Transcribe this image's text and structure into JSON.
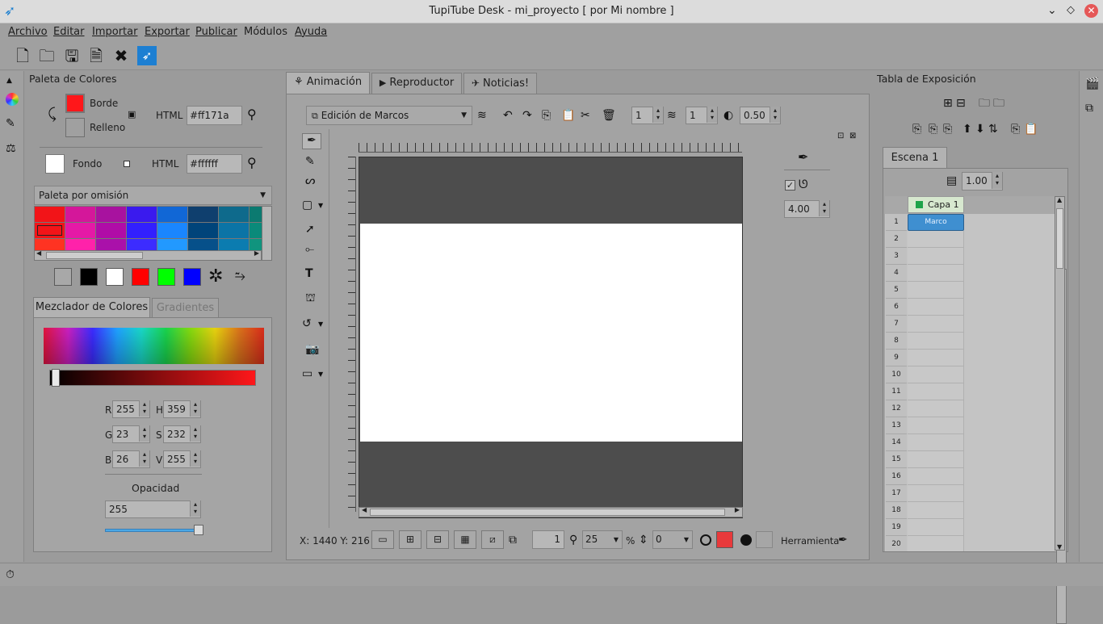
{
  "window": {
    "title": "TupiTube Desk - mi_proyecto [ por Mi nombre ]"
  },
  "menu": [
    "Archivo",
    "Editar",
    "Importar",
    "Exportar",
    "Publicar",
    "Módulos",
    "Ayuda"
  ],
  "palette": {
    "title": "Paleta de Colores",
    "border_label": "Borde",
    "fill_label": "Relleno",
    "html_label": "HTML",
    "border_html": "#ff171a",
    "bg_label": "Fondo",
    "bg_html": "#ffffff",
    "palette_select": "Paleta por omisión",
    "colors": {
      "border": "#ff171a",
      "fill": "#a0a0a0",
      "background": "#ffffff"
    },
    "swatches": [
      [
        "#f21418",
        "#d4179a",
        "#a8129f",
        "#3a1aee",
        "#1167d6",
        "#0f3f6e",
        "#0e6a8c",
        "#0b7a70"
      ],
      [
        "#f21418",
        "#e519a6",
        "#b00ca7",
        "#3220ff",
        "#1a86ff",
        "#00447a",
        "#0b74a6",
        "#0a8a7a"
      ],
      [
        "#ff3322",
        "#ff22aa",
        "#aa11aa",
        "#3c2cff",
        "#2299ff",
        "#06508a",
        "#0b7cb0",
        "#10947e"
      ]
    ],
    "quick": [
      "#a8a8a8",
      "#000000",
      "#ffffff",
      "#ff0000",
      "#00ff00",
      "#0000ff"
    ]
  },
  "mixer": {
    "tab_mixer": "Mezclador de Colores",
    "tab_gradients": "Gradientes",
    "r_label": "R",
    "r": "255",
    "h_label": "H",
    "h": "359",
    "g_label": "G",
    "g": "23",
    "s_label": "S",
    "s": "232",
    "b_label": "B",
    "b": "26",
    "v_label": "V",
    "v": "255",
    "opacity_label": "Opacidad",
    "opacity": "255"
  },
  "tabs": {
    "animation": "Animación",
    "player": "Reproductor",
    "news": "Noticias!"
  },
  "editor": {
    "mode": "Edición de Marcos",
    "spin1": "1",
    "spin2": "1",
    "opacity": "0.50",
    "pen_size": "4.00",
    "coords": "X: 1440 Y: 216",
    "frame": "1",
    "zoom": "25",
    "percent": "%",
    "rotation": "0",
    "tool_label": "Herramienta"
  },
  "exposure": {
    "title": "Tabla de Exposición",
    "scene_tab": "Escena 1",
    "fps": "1.00",
    "layer": "Capa 1",
    "frame_label": "Marco",
    "rows": [
      "1",
      "2",
      "3",
      "4",
      "5",
      "6",
      "7",
      "8",
      "9",
      "10",
      "11",
      "12",
      "13",
      "14",
      "15",
      "16",
      "17",
      "18",
      "19",
      "20"
    ]
  }
}
